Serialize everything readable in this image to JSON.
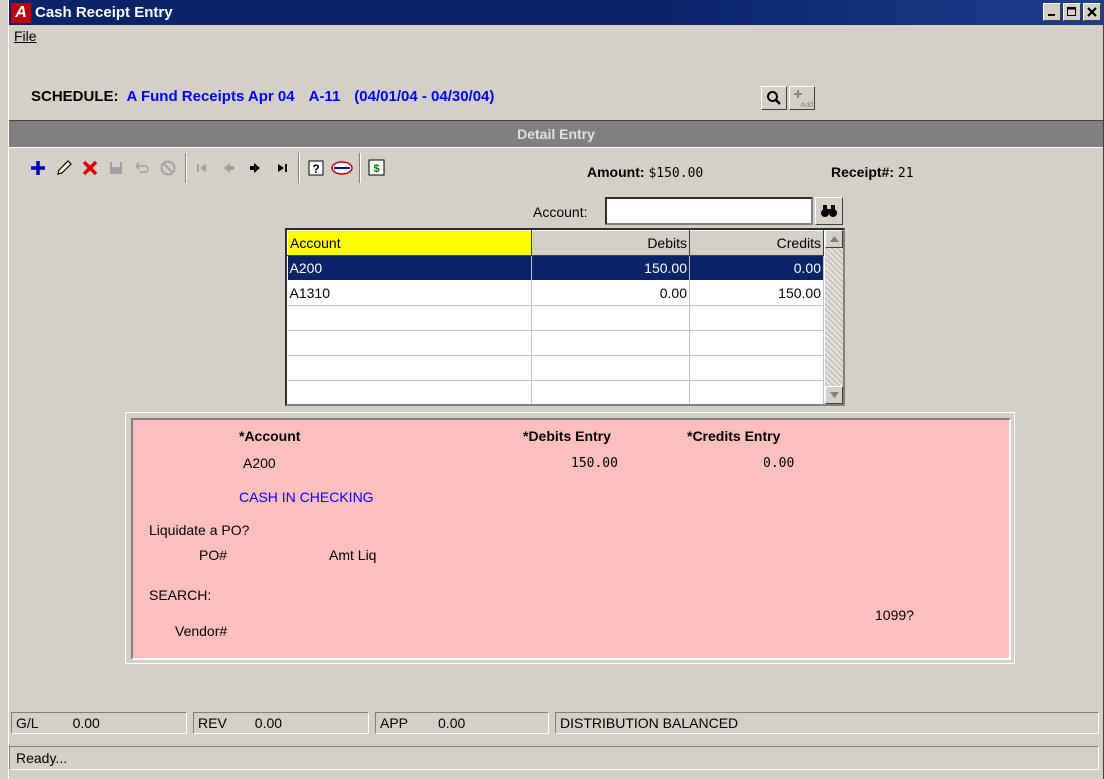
{
  "window": {
    "title": "Cash Receipt Entry",
    "app_icon_letter": "A",
    "controls": [
      "minimize-icon",
      "maximize-icon",
      "close-icon"
    ]
  },
  "menu": {
    "file": "File"
  },
  "schedule": {
    "label": "SCHEDULE:",
    "name": "A Fund Receipts Apr 04",
    "code": "A-11",
    "range": "(04/01/04 - 04/30/04)",
    "add_label": "Add"
  },
  "section": {
    "title": "Detail Entry"
  },
  "toolbar": {
    "icons": [
      "add-icon",
      "edit-icon",
      "delete-icon",
      "save-icon",
      "undo-icon",
      "cancel-icon",
      "first-record-icon",
      "previous-record-icon",
      "next-record-icon",
      "last-record-icon",
      "help-icon",
      "logo-icon",
      "calculator-icon"
    ]
  },
  "summary": {
    "amount_label": "Amount:",
    "amount_value": "$150.00",
    "receipt_label": "Receipt#:",
    "receipt_value": "21"
  },
  "account_search": {
    "label": "Account:",
    "value": ""
  },
  "grid": {
    "columns": [
      "Account",
      "Debits",
      "Credits"
    ],
    "rows": [
      {
        "account": "A200",
        "debits": "150.00",
        "credits": "0.00",
        "selected": true
      },
      {
        "account": "A1310",
        "debits": "0.00",
        "credits": "150.00",
        "selected": false
      }
    ]
  },
  "detail": {
    "account_label": "*Account",
    "debits_label": "*Debits Entry",
    "credits_label": "*Credits Entry",
    "account_value": "A200",
    "debits_value": "150.00",
    "credits_value": "0.00",
    "account_desc": "CASH IN CHECKING",
    "liquidate_label": "Liquidate a PO?",
    "po_label": "PO#",
    "amt_liq_label": "Amt Liq",
    "search_label": "SEARCH:",
    "vendor_label": "Vendor#",
    "form1099_label": "1099?"
  },
  "status": {
    "gl_label": "G/L",
    "gl_value": "0.00",
    "rev_label": "REV",
    "rev_value": "0.00",
    "app_label": "APP",
    "app_value": "0.00",
    "balance_msg": "DISTRIBUTION BALANCED",
    "ready": "Ready..."
  },
  "colors": {
    "title_bar": "#0a246a",
    "detail_panel": "#ffbfbf",
    "link_blue": "#0000ff",
    "selected_row": "#0a246a",
    "header_highlight": "#ffff00"
  }
}
